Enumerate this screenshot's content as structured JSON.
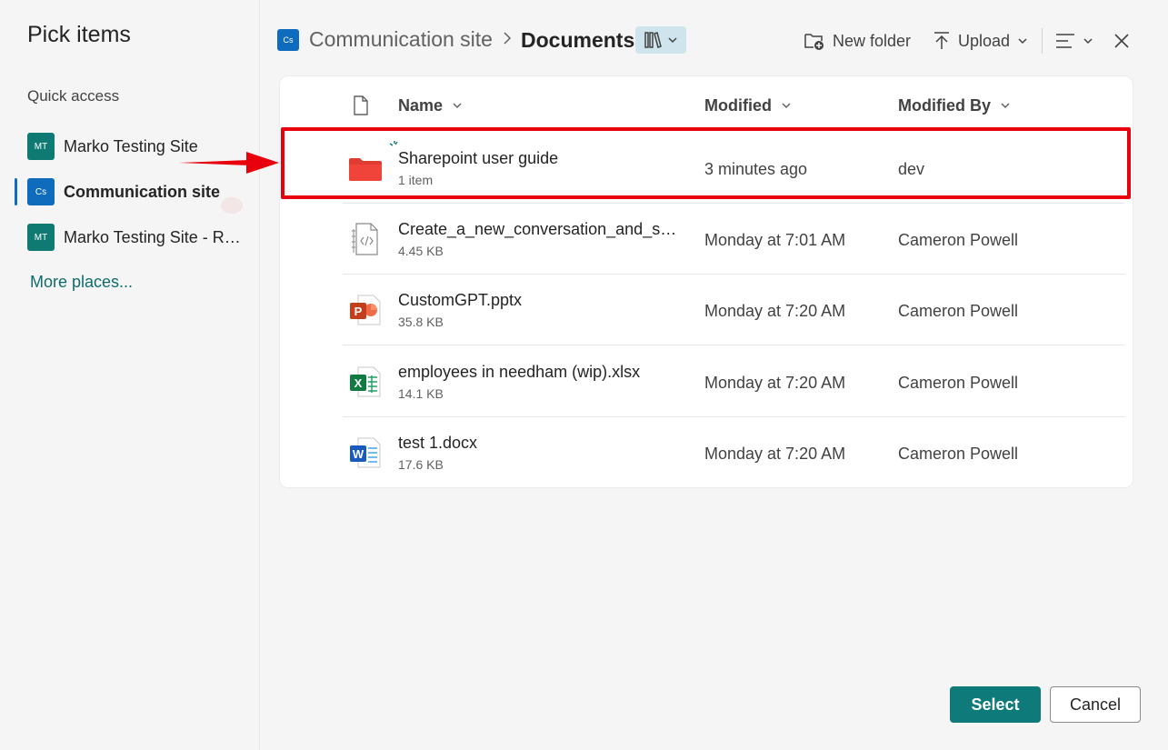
{
  "sidebar": {
    "title": "Pick items",
    "quick_access": "Quick access",
    "sites": [
      {
        "badge": "MT",
        "label": "Marko Testing Site",
        "color": "#0e7a72"
      },
      {
        "badge": "Cs",
        "label": "Communication site",
        "color": "#0f6cbd"
      },
      {
        "badge": "MT",
        "label": "Marko Testing Site - Ret...",
        "color": "#0e7a72"
      }
    ],
    "more_places": "More places..."
  },
  "header": {
    "site_badge": "Cs",
    "site": "Communication site",
    "separator": ">",
    "library": "Documents",
    "new_folder": "New folder",
    "upload": "Upload"
  },
  "columns": {
    "name": "Name",
    "modified": "Modified",
    "modified_by": "Modified By"
  },
  "files": [
    {
      "name": "Sharepoint user guide",
      "sub": "1 item",
      "modified": "3 minutes ago",
      "by": "dev",
      "icon": "folder-icon"
    },
    {
      "name": "Create_a_new_conversation_and_send_...",
      "sub": "4.45 KB",
      "modified": "Monday at 7:01 AM",
      "by": "Cameron Powell",
      "icon": "code-file-icon"
    },
    {
      "name": "CustomGPT.pptx",
      "sub": "35.8 KB",
      "modified": "Monday at 7:20 AM",
      "by": "Cameron Powell",
      "icon": "powerpoint-icon"
    },
    {
      "name": "employees in needham (wip).xlsx",
      "sub": "14.1 KB",
      "modified": "Monday at 7:20 AM",
      "by": "Cameron Powell",
      "icon": "excel-icon"
    },
    {
      "name": "test 1.docx",
      "sub": "17.6 KB",
      "modified": "Monday at 7:20 AM",
      "by": "Cameron Powell",
      "icon": "word-icon"
    }
  ],
  "footer": {
    "select": "Select",
    "cancel": "Cancel"
  },
  "colors": {
    "accent": "#0f7a7a",
    "highlight": "#e8000d",
    "folder": "#e03c31"
  }
}
